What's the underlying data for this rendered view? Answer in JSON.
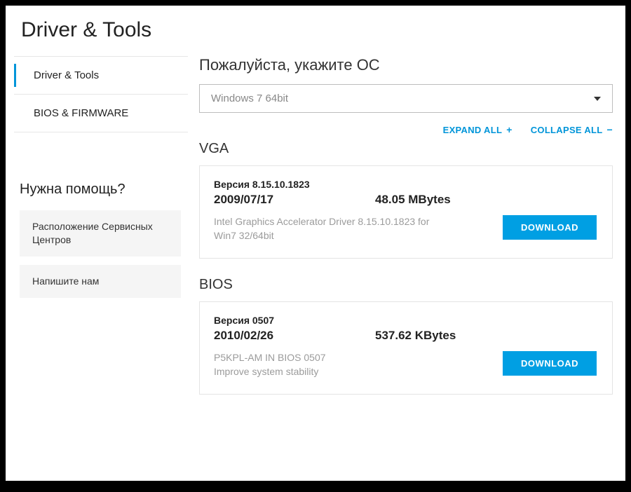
{
  "header": {
    "title": "Driver & Tools"
  },
  "sidebar": {
    "tabs": [
      {
        "label": "Driver & Tools",
        "active": true
      },
      {
        "label": "BIOS & FIRMWARE",
        "active": false
      }
    ],
    "help_title": "Нужна помощь?",
    "help_buttons": [
      {
        "label": "Расположение Сервисных Центров"
      },
      {
        "label": "Напишите нам"
      }
    ]
  },
  "main": {
    "os_label": "Пожалуйста, укажите ОС",
    "os_selected": "Windows 7 64bit",
    "expand_all": "EXPAND ALL",
    "collapse_all": "COLLAPSE ALL",
    "download_label": "DOWNLOAD",
    "sections": [
      {
        "title": "VGA",
        "version": "Версия 8.15.10.1823",
        "date": "2009/07/17",
        "size": "48.05 MBytes",
        "description": "Intel Graphics Accelerator Driver 8.15.10.1823 for Win7 32/64bit"
      },
      {
        "title": "BIOS",
        "version": "Версия 0507",
        "date": "2010/02/26",
        "size": "537.62 KBytes",
        "description": "P5KPL-AM IN BIOS 0507\nImprove system stability"
      }
    ]
  }
}
